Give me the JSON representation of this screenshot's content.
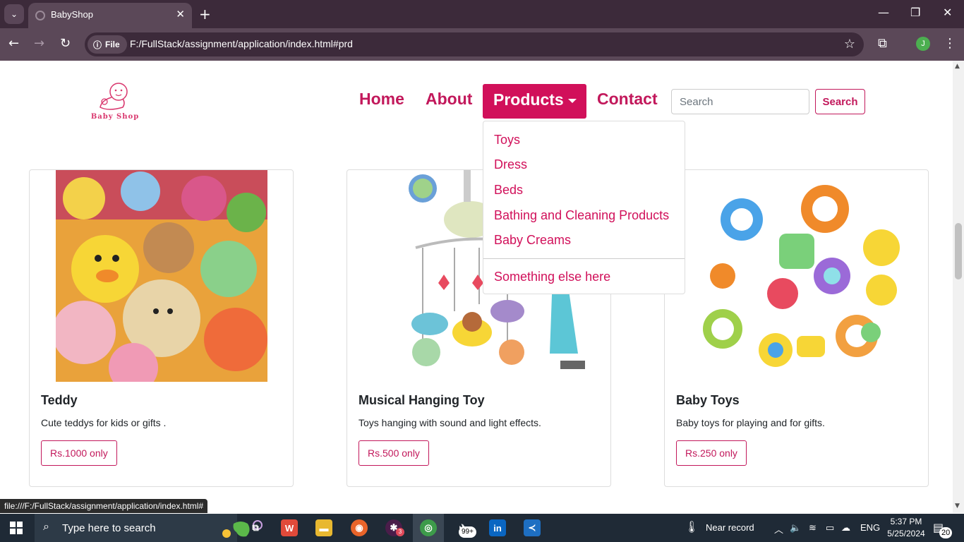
{
  "browser": {
    "tab_title": "BabyShop",
    "file_chip": "File",
    "url": "F:/FullStack/assignment/application/index.html#prd",
    "status_url": "file:///F:/FullStack/assignment/application/index.html#"
  },
  "site": {
    "logo_text": "Baby Shop",
    "nav": {
      "home": "Home",
      "about": "About",
      "products": "Products",
      "contact": "Contact"
    },
    "search": {
      "placeholder": "Search",
      "button": "Search"
    },
    "dropdown": {
      "items": [
        "Toys",
        "Dress",
        "Beds",
        "Bathing and Cleaning Products",
        "Baby Creams"
      ],
      "extra": "Something else here"
    },
    "cards": [
      {
        "title": "Teddy",
        "text": "Cute teddys for kids or gifts .",
        "price": "Rs.1000 only"
      },
      {
        "title": "Musical Hanging Toy",
        "text": "Toys hanging with sound and light effects.",
        "price": "Rs.500 only"
      },
      {
        "title": "Baby Toys",
        "text": "Baby toys for playing and for gifts.",
        "price": "Rs.250 only"
      }
    ]
  },
  "taskbar": {
    "search_placeholder": "Type here to search",
    "badge_slack": "3",
    "badge_mail": "99+",
    "weather": "Near record",
    "language": "ENG",
    "time": "5:37 PM",
    "date": "5/25/2024",
    "notifications": "20"
  },
  "colors": {
    "brand": "#c2185b",
    "brand_fill": "#d1105a",
    "chrome": "#3c2a3a"
  }
}
